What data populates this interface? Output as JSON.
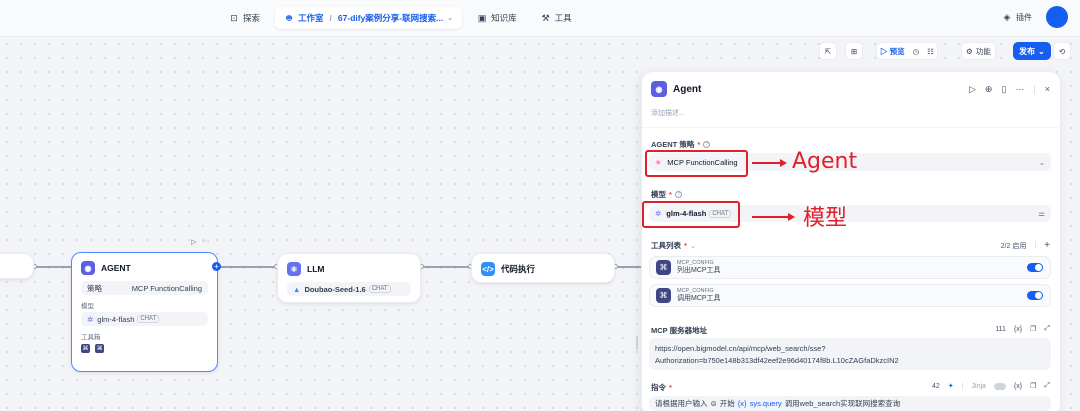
{
  "nav": {
    "explore": "探索",
    "studio": "工作室",
    "app_name": "67-dify案例分享-联网搜索...",
    "knowledge": "知识库",
    "tools": "工具",
    "plugins": "插件"
  },
  "toolbar": {
    "preview": "预览",
    "features": "功能",
    "publish": "发布"
  },
  "nodes": {
    "agent": {
      "title": "AGENT",
      "strategy_label": "策略",
      "strategy_value": "MCP FunctionCalling",
      "model_label": "模型",
      "model_value": "glm-4-flash",
      "model_tag": "CHAT",
      "tools_label": "工具箱"
    },
    "llm": {
      "title": "LLM",
      "model_value": "Doubao-Seed-1.6",
      "model_tag": "CHAT"
    },
    "code": {
      "title": "代码执行"
    }
  },
  "panel": {
    "title": "Agent",
    "description_placeholder": "添加描述...",
    "strategy_label": "AGENT 策略",
    "strategy_value": "MCP FunctionCalling",
    "model_label": "模型",
    "model_value": "glm-4-flash",
    "model_tag": "CHAT",
    "tools_label": "工具列表",
    "tools_count": "2/2 启用",
    "tools": [
      {
        "provider": "MCP_CONFIG",
        "name": "列出MCP工具",
        "enabled": true
      },
      {
        "provider": "MCP_CONFIG",
        "name": "调用MCP工具",
        "enabled": true
      }
    ],
    "mcp_label": "MCP 服务器地址",
    "mcp_count": "111",
    "mcp_url_line1": "https://open.bigmodel.cn/api/mcp/web_search/sse?",
    "mcp_url_line2": "Authorization=b750e148b313df42eef2e96d40174f8b.L10cZAGfaDkzcIN2",
    "instruction_label": "指令",
    "instruction_count": "42",
    "jinja": "Jinja",
    "instruction_text_prefix": "请根据用户输入",
    "instruction_var_node": "开始",
    "instruction_var_name": "sys.query",
    "instruction_text_suffix": "调用web_search实现联网搜索查询"
  },
  "annotations": {
    "agent": "Agent",
    "model": "模型"
  },
  "colors": {
    "accent": "#155eef",
    "annotation": "#e0202a"
  }
}
